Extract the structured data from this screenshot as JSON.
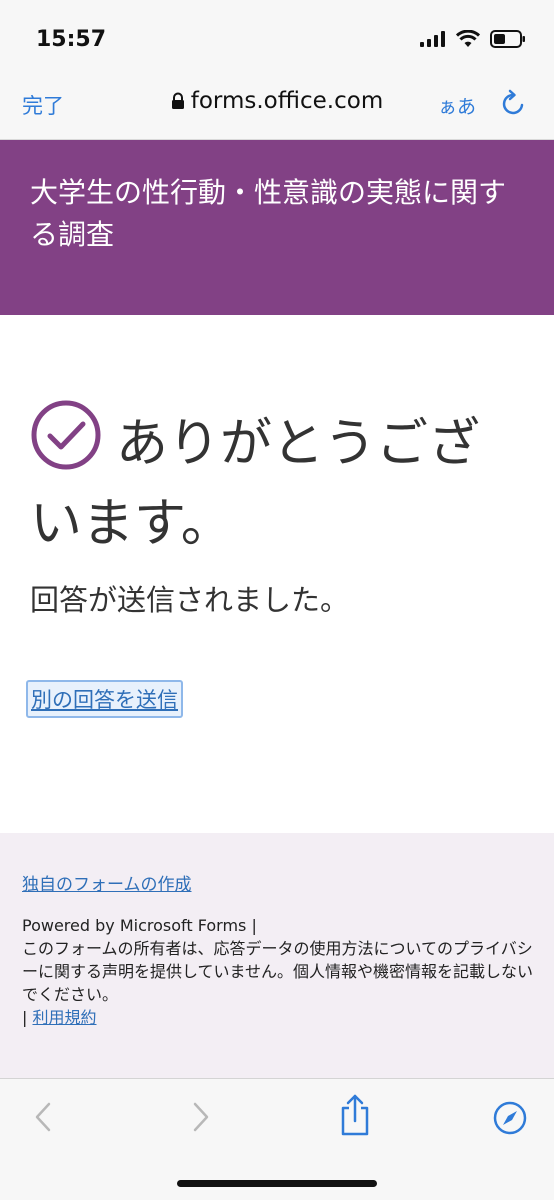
{
  "status_bar": {
    "time": "15:57"
  },
  "browser": {
    "done_label": "完了",
    "url": "forms.office.com",
    "text_size_label": "ぁあ"
  },
  "form": {
    "title": "大学生の性行動・性意識の実態に関する調査",
    "thank_you": "ありがとうございます。",
    "submitted_message": "回答が送信されました。",
    "submit_another_label": "別の回答を送信"
  },
  "footer": {
    "create_form_label": "独自のフォームの作成",
    "powered_by": "Powered by Microsoft Forms |",
    "privacy_notice": "このフォームの所有者は、応答データの使用方法についてのプライバシーに関する声明を提供していません。個人情報や機密情報を記載しないでください。",
    "separator": "| ",
    "terms_label": "利用規約"
  },
  "colors": {
    "accent": "#824185",
    "link": "#2f6fb8",
    "ios_blue": "#2f7bd8",
    "footer_bg": "#f3eef4"
  },
  "icons": {
    "status": [
      "signal-icon",
      "wifi-icon",
      "battery-icon"
    ],
    "toolbar": [
      "back-icon",
      "forward-icon",
      "share-icon",
      "safari-compass-icon"
    ]
  }
}
